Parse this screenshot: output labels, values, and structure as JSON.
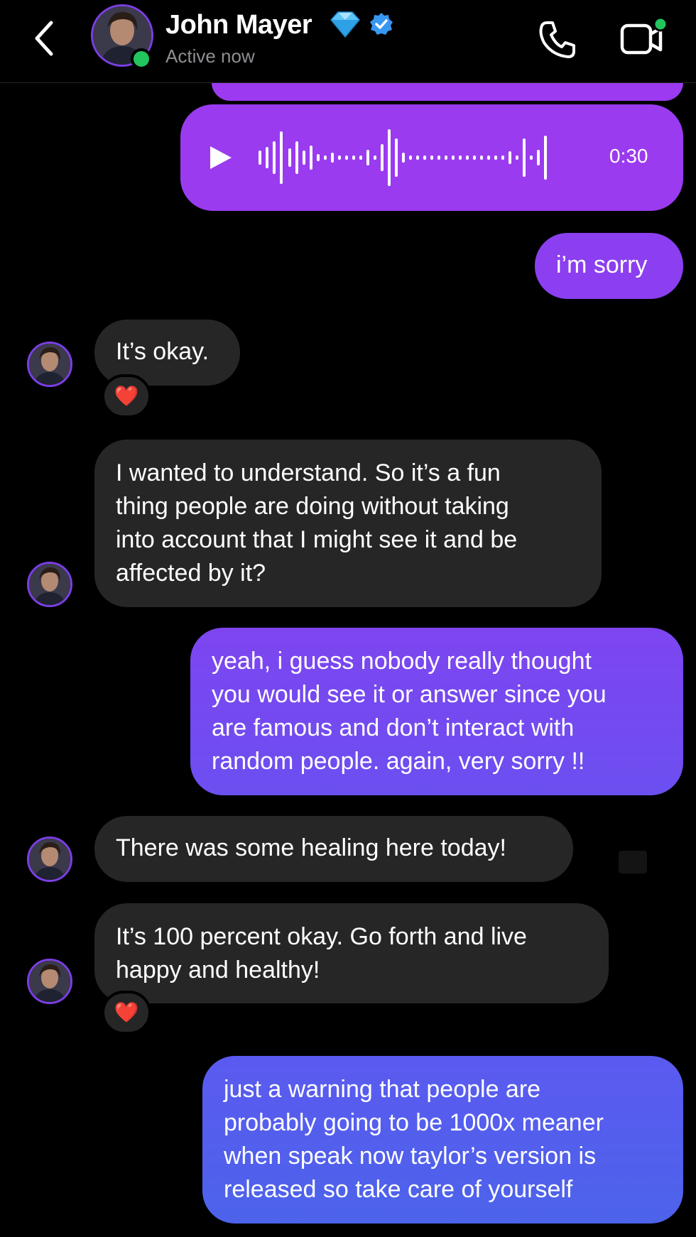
{
  "header": {
    "contact_name": "John Mayer",
    "status": "Active now",
    "icons": [
      "back-chevron-icon",
      "diamond-icon",
      "verified-badge-icon",
      "phone-icon",
      "video-call-icon"
    ]
  },
  "colors": {
    "background": "#000000",
    "incoming_bubble": "#262626",
    "outgoing_top": "#9b3af0",
    "outgoing_bottom": "#4f62ea",
    "avatar_ring": "#7b3fe4",
    "online": "#22c55e"
  },
  "messages": {
    "voice": {
      "duration": "0:30"
    },
    "m1": "i’m sorry",
    "m2": "It’s okay.",
    "m2_reaction": "❤️",
    "m3_lines": [
      "I wanted to understand. So it’s a fun",
      "thing people are doing without taking",
      "into account that I might see it and be",
      "affected by it?"
    ],
    "m4_lines": [
      "yeah, i guess nobody really thought",
      "you would see it or answer since you",
      "are famous and don’t interact with",
      "random people. again, very sorry !!"
    ],
    "m5": "There was some healing here today!",
    "m6_lines": [
      "It’s 100 percent okay. Go forth and live",
      "happy and healthy!"
    ],
    "m6_reaction": "❤️",
    "m7_lines": [
      "just a warning that people are",
      "probably going to be 1000x meaner",
      "when speak now taylor’s version is",
      "released so take care of yourself"
    ]
  }
}
